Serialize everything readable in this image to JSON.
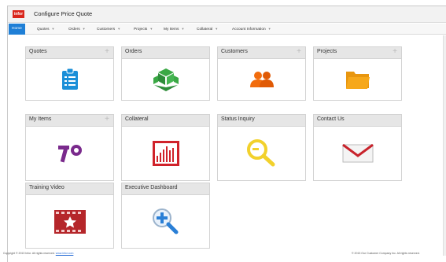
{
  "app": {
    "logo_text": "infor",
    "title": "Configure Price Quote"
  },
  "nav": {
    "items": [
      {
        "label": "Home",
        "active": true,
        "caret": false
      },
      {
        "label": "Quotes",
        "caret": true
      },
      {
        "label": "Orders",
        "caret": true
      },
      {
        "label": "Customers",
        "caret": true
      },
      {
        "label": "Projects",
        "caret": true
      },
      {
        "label": "My Items",
        "caret": true
      },
      {
        "label": "Collateral",
        "caret": true
      },
      {
        "label": "Account Information",
        "caret": true
      }
    ]
  },
  "tiles": [
    {
      "title": "Quotes",
      "plus": "+",
      "icon": "clipboard-icon"
    },
    {
      "title": "Orders",
      "plus": "",
      "icon": "package-icon"
    },
    {
      "title": "Customers",
      "plus": "+",
      "icon": "users-icon"
    },
    {
      "title": "Projects",
      "plus": "+",
      "icon": "folder-icon"
    },
    {
      "title": "My Items",
      "plus": "+",
      "icon": "tools-icon"
    },
    {
      "title": "Collateral",
      "plus": "",
      "icon": "bar-chart-icon"
    },
    {
      "title": "Status Inquiry",
      "plus": "",
      "icon": "search-icon"
    },
    {
      "title": "Contact Us",
      "plus": "",
      "icon": "mail-icon"
    },
    {
      "title": "Training Video",
      "plus": "",
      "icon": "video-film-icon"
    },
    {
      "title": "Executive Dashboard",
      "plus": "",
      "icon": "zoom-in-icon"
    }
  ],
  "footer": {
    "left_text": "Copyright © 2013 Infor. All rights reserved.",
    "left_link": "www.infor.com",
    "right_text": "© 2013 Our Customer Company Inc. All rights reserved."
  },
  "colors": {
    "accent": "#1f7fd6",
    "brand_red": "#d9261c",
    "clipboard": "#1a8fd8",
    "package": "#3aa845",
    "users": "#f26c0d",
    "folder": "#f6a81b",
    "tools": "#7a2a8c",
    "chart": "#d0222a",
    "search": "#f2d12c",
    "mail": "#c8232c",
    "video": "#b5262a",
    "zoom": "#2a7fd6"
  }
}
